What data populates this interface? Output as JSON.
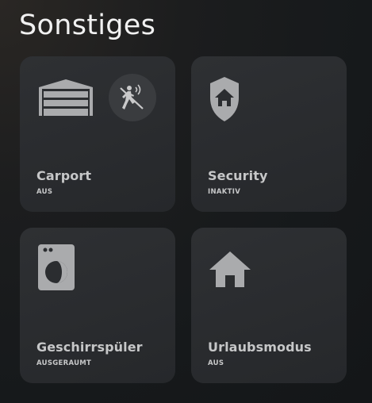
{
  "section": {
    "title": "Sonstiges"
  },
  "tiles": [
    {
      "title": "Carport",
      "state": "AUS",
      "icon": "garage-icon",
      "badge_icon": "motion-sensor-off-icon"
    },
    {
      "title": "Security",
      "state": "INAKTIV",
      "icon": "shield-home-icon"
    },
    {
      "title": "Geschirrspüler",
      "state": "AUSGERAUMT",
      "icon": "dishwasher-icon"
    },
    {
      "title": "Urlaubsmodus",
      "state": "AUS",
      "icon": "home-icon"
    }
  ],
  "colors": {
    "tile_background": "#2c2e31",
    "icon": "#aaabad",
    "text": "#c6c7c8",
    "title": "#f1f1f1"
  }
}
